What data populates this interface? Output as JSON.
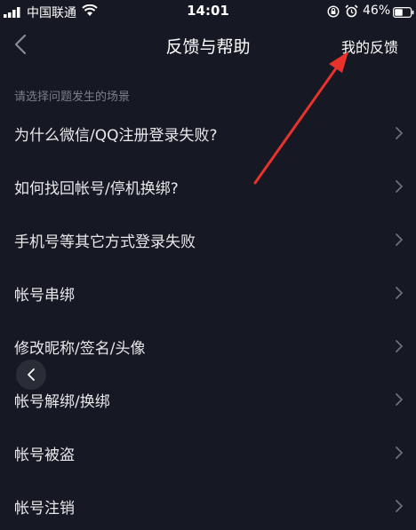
{
  "status_bar": {
    "carrier": "中国联通",
    "time": "14:01",
    "battery_percent": "46%",
    "icons": [
      "signal-icon",
      "wifi-icon",
      "orientation-lock-icon",
      "alarm-icon",
      "battery-icon"
    ]
  },
  "nav": {
    "title": "反馈与帮助",
    "right_action": "我的反馈",
    "back_icon": "chevron-left-icon"
  },
  "section_hint": "请选择问题发生的场景",
  "faq_items": [
    {
      "label": "为什么微信/QQ注册登录失败?"
    },
    {
      "label": "如何找回帐号/停机换绑?"
    },
    {
      "label": "手机号等其它方式登录失败"
    },
    {
      "label": "帐号串绑"
    },
    {
      "label": "修改昵称/签名/头像"
    },
    {
      "label": "帐号解绑/换绑"
    },
    {
      "label": "帐号被盗"
    },
    {
      "label": "帐号注销"
    }
  ],
  "colors": {
    "background": "#161823",
    "text_primary": "#ffffff",
    "text_secondary": "#7d7f88",
    "annotation_red": "#e8322c"
  }
}
